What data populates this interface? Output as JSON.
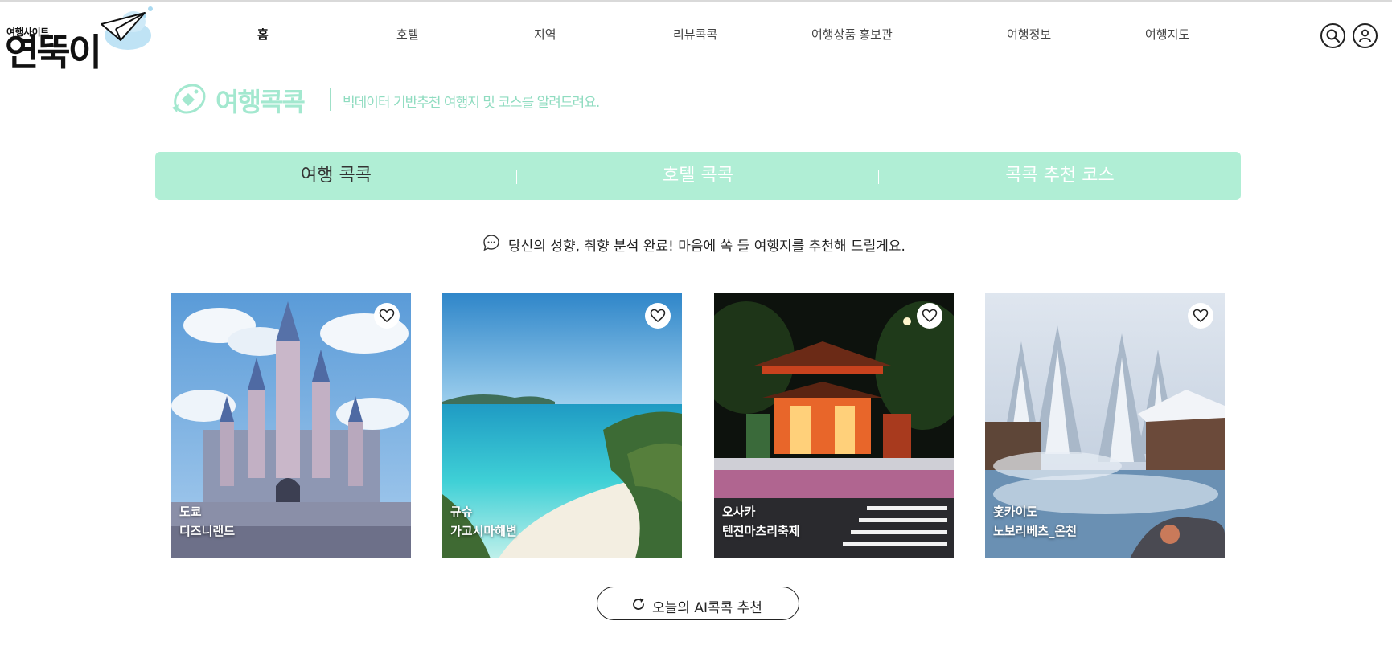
{
  "logo": {
    "small": "여행사이트",
    "big": "연뚝이"
  },
  "nav": [
    {
      "label": "홈",
      "active": true
    },
    {
      "label": "호텔"
    },
    {
      "label": "지역"
    },
    {
      "label": "리뷰콕콕"
    },
    {
      "label": "여행상품 홍보관"
    },
    {
      "label": "여행정보"
    },
    {
      "label": "여행지도"
    }
  ],
  "header_icons": [
    "search-icon",
    "user-icon"
  ],
  "section": {
    "title": "여행콕콕",
    "subtitle": "빅데이터 기반추천  여행지 및 코스를 알려드려요."
  },
  "tabs": [
    {
      "label": "여행 콕콕",
      "active": true
    },
    {
      "label": "호텔 콕콕"
    },
    {
      "label": "콕콕 추천 코스"
    }
  ],
  "message": "당신의 성향, 취향 분석 완료! 마음에 쏙 들 여행지를 추천해 드릴게요.",
  "cards": [
    {
      "region": "도쿄",
      "name": "디즈니랜드"
    },
    {
      "region": "규슈",
      "name": "가고시마해변"
    },
    {
      "region": "오사카",
      "name": "텐진마츠리축제"
    },
    {
      "region": "홋카이도",
      "name": "노보리베츠_온천"
    }
  ],
  "refresh_button": {
    "label": "오늘의 AI콕콕 추천"
  },
  "colors": {
    "mint": "#b0eed5",
    "mint_text": "#a3e8cf"
  }
}
